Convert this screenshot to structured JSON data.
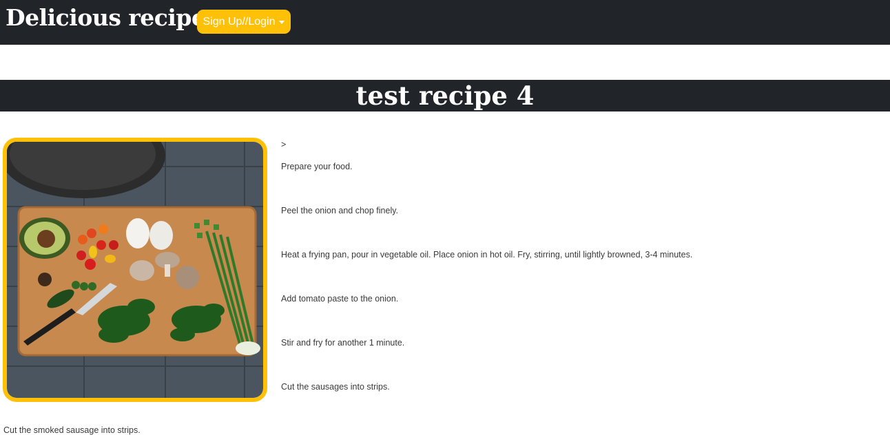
{
  "header": {
    "brand": "Delicious recipes",
    "signup_label": "Sign Up//Login"
  },
  "recipe": {
    "title": "test recipe 4",
    "image_alt": "cutting board with vegetables",
    "marker": ">",
    "steps": [
      "Prepare your food.",
      "Peel the onion and chop finely.",
      "Heat a frying pan, pour in vegetable oil. Place onion in hot oil. Fry, stirring, until lightly browned, 3-4 minutes.",
      "Add tomato paste to the onion.",
      "Stir and fry for another 1 minute.",
      "Cut the sausages into strips."
    ],
    "extra_step": "Cut the smoked sausage into strips."
  },
  "colors": {
    "navbar": "#212529",
    "accent": "#ffc107"
  }
}
